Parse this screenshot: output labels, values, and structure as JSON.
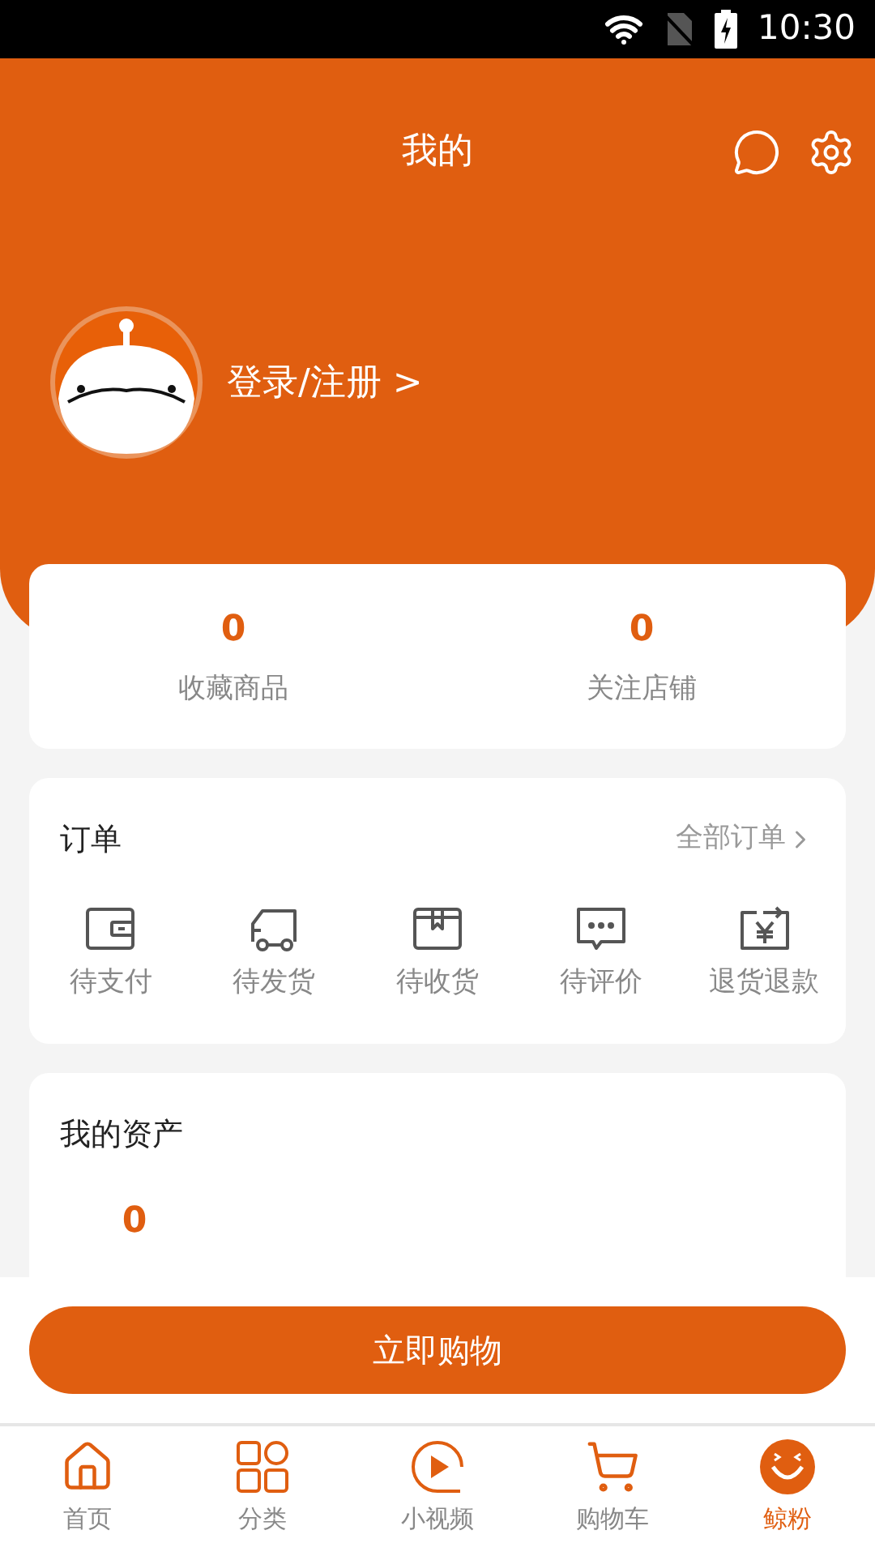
{
  "status_bar": {
    "time": "10:30"
  },
  "header": {
    "title": "我的",
    "login": "登录/注册 >"
  },
  "stats": [
    {
      "value": "0",
      "label": "收藏商品"
    },
    {
      "value": "0",
      "label": "关注店铺"
    }
  ],
  "orders": {
    "title": "订单",
    "all_link": "全部订单",
    "items": [
      {
        "kind": "wallet",
        "label": "待支付"
      },
      {
        "kind": "truck",
        "label": "待发货"
      },
      {
        "kind": "box",
        "label": "待收货"
      },
      {
        "kind": "comment",
        "label": "待评价"
      },
      {
        "kind": "refund",
        "label": "退货退款"
      }
    ]
  },
  "assets": {
    "title": "我的资产",
    "items": [
      {
        "value": "0"
      }
    ]
  },
  "shop_button": "立即购物",
  "tabs": [
    {
      "kind": "home",
      "label": "首页",
      "selected": false
    },
    {
      "kind": "category",
      "label": "分类",
      "selected": false
    },
    {
      "kind": "video",
      "label": "小视频",
      "selected": false
    },
    {
      "kind": "cart",
      "label": "购物车",
      "selected": false
    },
    {
      "kind": "me",
      "label": "鲸粉",
      "selected": true
    }
  ]
}
